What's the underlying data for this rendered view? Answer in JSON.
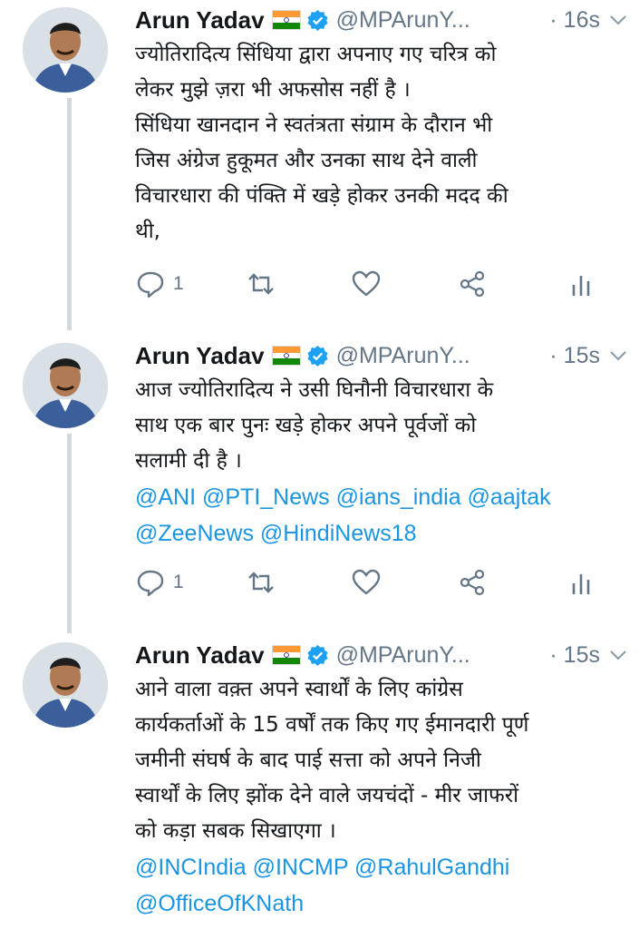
{
  "tweets": [
    {
      "author": "Arun Yadav",
      "handle": "@MPArunY...",
      "time": "· 16s",
      "text_lines": [
        "ज्योतिरादित्य सिंधिया द्वारा अपनाए गए चरित्र को",
        "लेकर मुझे ज़रा भी अफसोस नहीं है ।",
        "सिंधिया खानदान ने स्वतंत्रता संग्राम के दौरान भी",
        "जिस अंग्रेज हुकूमत और उनका साथ देने वाली",
        "विचारधारा की पंक्ति में खड़े होकर उनकी मदद की",
        "थी,"
      ],
      "mention_lines": [],
      "reply_count": "1",
      "icons": [
        "reply-icon",
        "retweet-icon",
        "like-icon",
        "share-icon",
        "analytics-icon"
      ]
    },
    {
      "author": "Arun Yadav",
      "handle": "@MPArunY...",
      "time": "· 15s",
      "text_lines": [
        "आज ज्योतिरादित्य ने उसी घिनौनी विचारधारा के",
        "साथ एक बार पुनः खड़े होकर अपने पूर्वजों को",
        "सलामी दी है ।"
      ],
      "mention_lines": [
        "@ANI @PTI_News @ians_india @aajtak",
        "@ZeeNews @HindiNews18"
      ],
      "reply_count": "1",
      "icons": [
        "reply-icon",
        "retweet-icon",
        "like-icon",
        "share-icon",
        "analytics-icon"
      ]
    },
    {
      "author": "Arun Yadav",
      "handle": "@MPArunY...",
      "time": "· 15s",
      "text_lines": [
        "आने वाला वक़्त अपने स्वार्थों के लिए कांग्रेस",
        "कार्यकर्ताओं के 15 वर्षों तक किए गए ईमानदारी पूर्ण",
        "जमीनी संघर्ष के बाद पाई सत्ता को अपने निजी",
        "स्वार्थों के लिए झोंक देने वाले जयचंदों - मीर जाफरों",
        "को  कड़ा सबक सिखाएगा ।"
      ],
      "mention_lines": [
        "@INCIndia @INCMP @RahulGandhi",
        "@OfficeOfKNath"
      ],
      "reply_count": "",
      "icons": []
    }
  ],
  "colors": {
    "link": "#1b95e0",
    "muted": "#657786",
    "verified": "#1da1f2"
  }
}
